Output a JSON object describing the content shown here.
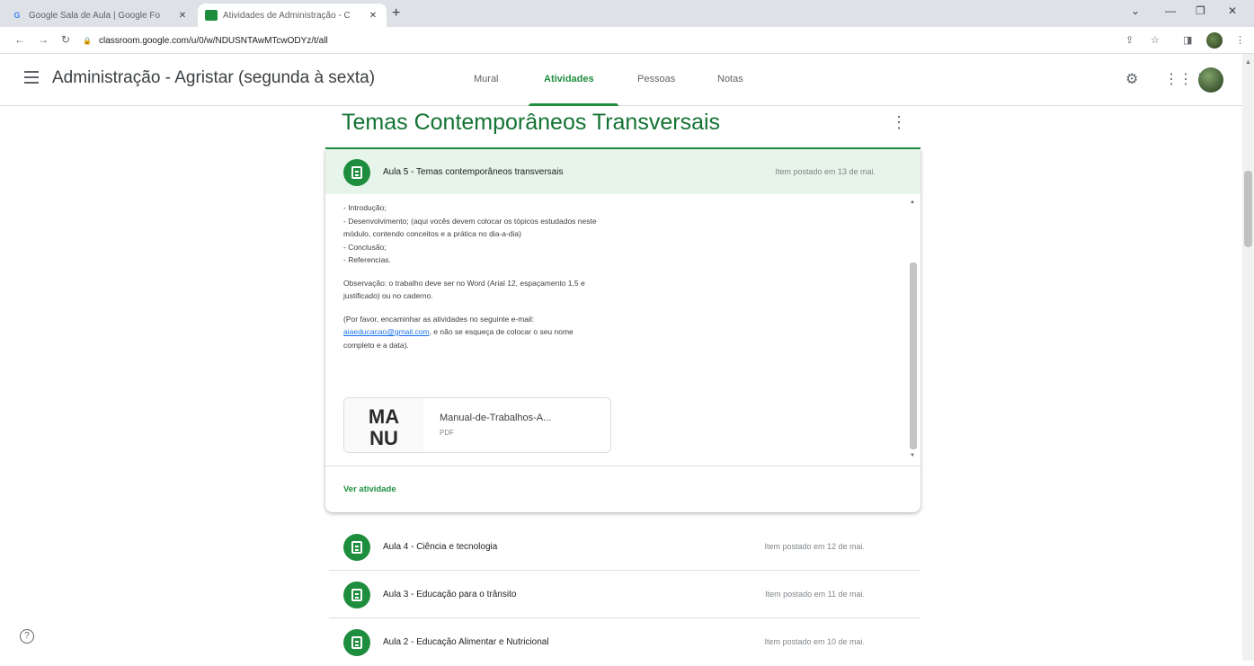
{
  "browser": {
    "tabs": [
      {
        "title": "Google Sala de Aula | Google Fo"
      },
      {
        "title": "Atividades de Administração - C"
      }
    ],
    "new_tab_symbol": "+",
    "url": "classroom.google.com/u/0/w/NDUSNTAwMTcwODYz/t/all"
  },
  "header": {
    "class_title": "Administração - Agristar (segunda à sexta)",
    "nav_tabs": [
      "Mural",
      "Atividades",
      "Pessoas",
      "Notas"
    ],
    "active_tab": "Atividades"
  },
  "topic": {
    "title": "Temas Contemporâneos Transversais"
  },
  "expanded_assignment": {
    "title": "Aula 5 - Temas contemporâneos transversais",
    "posted": "Item postado em 13 de mai.",
    "description": {
      "l1": "- Introdução;",
      "l2": "- Desenvolvimento; (aqui vocês devem colocar os tópicos estudados neste",
      "l3": "módulo, contendo conceitos e a prática no dia-a-dia)",
      "l4": "- Conclusão;",
      "l5": "- Referencias.",
      "obs1": "Observação: o trabalho deve ser no Word (Arial 12, espaçamento 1,5 e",
      "obs2": "justificado) ou no caderno.",
      "req1": "(Por favor, encaminhar as atividades no seguinte e-mail:",
      "email": "aiaeducacao@gmail.com",
      "req2": ", e não se esqueça de colocar o seu nome",
      "req3": "completo e a data)."
    },
    "attachment": {
      "name": "Manual-de-Trabalhos-A...",
      "type": "PDF",
      "thumb_text": [
        "MA",
        "NU"
      ]
    },
    "see_activity": "Ver atividade"
  },
  "assignments": [
    {
      "title": "Aula 4 - Ciência e tecnologia",
      "posted": "Item postado em 12 de mai."
    },
    {
      "title": "Aula 3 - Educação para o trânsito",
      "posted": "Item postado em 11 de mai."
    },
    {
      "title": "Aula 2 - Educação Alimentar e Nutricional",
      "posted": "Item postado em 10 de mai."
    }
  ],
  "colors": {
    "accent": "#1e8e3e",
    "title_green": "#137333",
    "header_bg": "#e6f4ea"
  }
}
